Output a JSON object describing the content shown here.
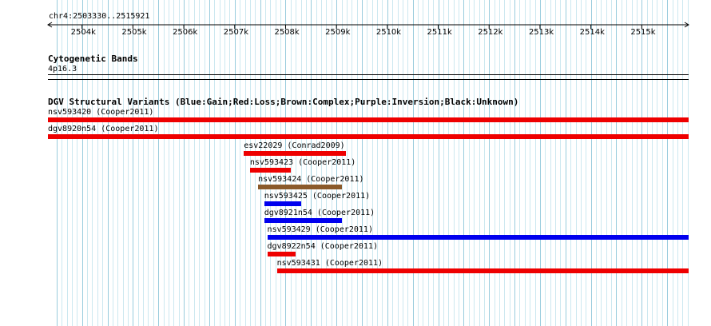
{
  "ruler": {
    "position": "chr4:2503330..2515921",
    "ticks": [
      "2504k",
      "2505k",
      "2506k",
      "2507k",
      "2508k",
      "2509k",
      "2510k",
      "2511k",
      "2512k",
      "2513k",
      "2514k",
      "2515k"
    ]
  },
  "cytoband_track": {
    "title": "Cytogenetic Bands",
    "band": "4p16.3"
  },
  "dgv_track": {
    "title": "DGV Structural Variants (Blue:Gain;Red:Loss;Brown:Complex;Purple:Inversion;Black:Unknown)",
    "legend_colors": {
      "gain": "#0000ee",
      "loss": "#ee0000",
      "complex": "#8b5a2b",
      "inversion": "#800080",
      "unknown": "#000000"
    },
    "features": [
      {
        "label": "nsv593420 (Cooper2011)",
        "type": "loss",
        "start": 2503330,
        "end": 2515921
      },
      {
        "label": "dgv8920n54 (Cooper2011)",
        "type": "loss",
        "start": 2503330,
        "end": 2515921
      },
      {
        "label": "esv22029 (Conrad2009)",
        "type": "loss",
        "start": 2507180,
        "end": 2509180
      },
      {
        "label": "nsv593423 (Cooper2011)",
        "type": "loss",
        "start": 2507300,
        "end": 2508110
      },
      {
        "label": "nsv593424 (Cooper2011)",
        "type": "complex",
        "start": 2507460,
        "end": 2509100
      },
      {
        "label": "nsv593425 (Cooper2011)",
        "type": "gain",
        "start": 2507580,
        "end": 2508300
      },
      {
        "label": "dgv8921n54 (Cooper2011)",
        "type": "gain",
        "start": 2507580,
        "end": 2509100
      },
      {
        "label": "nsv593429 (Cooper2011)",
        "type": "gain",
        "start": 2507640,
        "end": 2515921
      },
      {
        "label": "dgv8922n54 (Cooper2011)",
        "type": "loss",
        "start": 2507640,
        "end": 2508200
      },
      {
        "label": "nsv593431 (Cooper2011)",
        "type": "loss",
        "start": 2507830,
        "end": 2515921
      }
    ]
  }
}
